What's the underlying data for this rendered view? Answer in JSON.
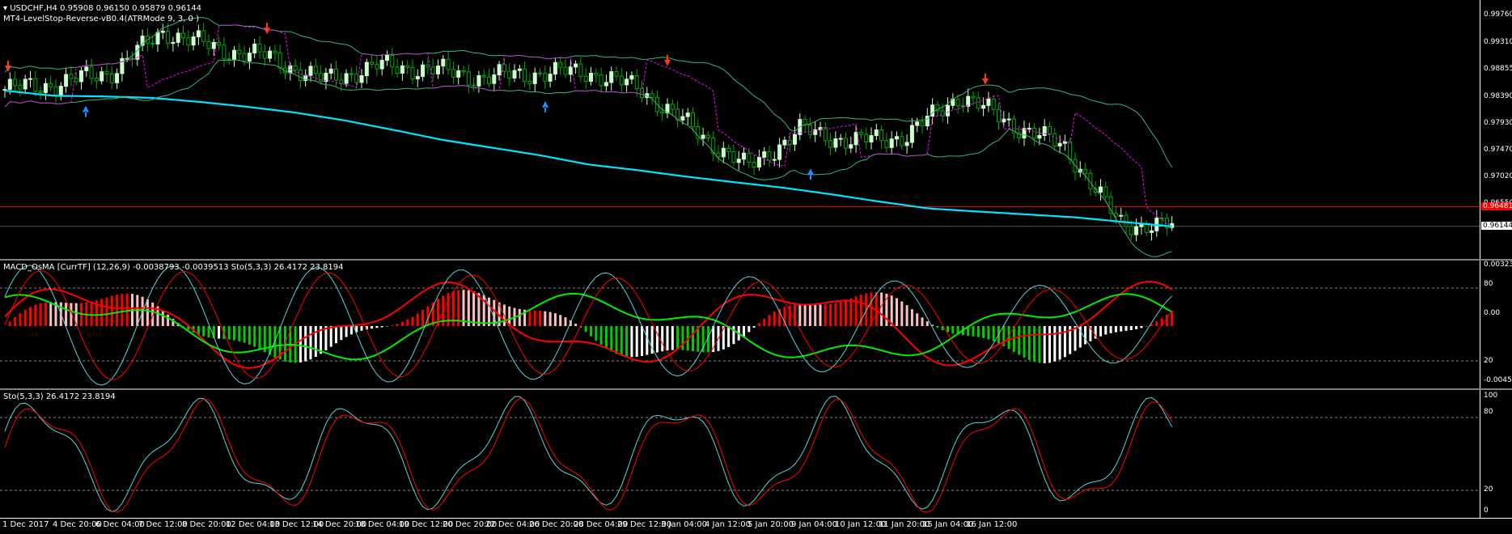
{
  "header": {
    "symbol_line": "USDCHF,H4  0.95908 0.96150 0.95879 0.96144",
    "indicator": "MT4-LevelStop-Reverse-vB0.4(ATRMode 9, 3, 0 )"
  },
  "macd_panel": {
    "title": "MACD_OsMA [CurrTF] (12,26,9) -0.0038793 -0.0039513  Sto(5,3,3) 26.4172 23.8194",
    "axis": [
      "0.003236",
      "80",
      "0.00",
      "20",
      "-0.004563"
    ]
  },
  "sto_panel": {
    "title": "Sto(5,3,3) 26.4172 23.8194",
    "axis": [
      "100",
      "80",
      "20",
      "0"
    ]
  },
  "price_axis": [
    "0.99760",
    "0.99310",
    "0.98855",
    "0.98390",
    "0.97930",
    "0.97470",
    "0.97020",
    "0.96550"
  ],
  "price_tags": {
    "level": "0.96481",
    "current": "0.96144"
  },
  "time_axis": [
    "1 Dec 2017",
    "4 Dec 20:00",
    "6 Dec 04:00",
    "7 Dec 12:00",
    "8 Dec 20:00",
    "12 Dec 04:00",
    "13 Dec 12:00",
    "14 Dec 20:00",
    "18 Dec 04:00",
    "19 Dec 12:00",
    "20 Dec 20:00",
    "22 Dec 04:00",
    "26 Dec 20:00",
    "28 Dec 04:00",
    "29 Dec 12:00",
    "3 Jan 04:00",
    "4 Jan 12:00",
    "5 Jan 20:00",
    "9 Jan 04:00",
    "10 Jan 12:00",
    "11 Jan 20:00",
    "15 Jan 04:00",
    "16 Jan 12:00"
  ],
  "colors": {
    "background": "#000000",
    "bull_candle": "#ccffcc",
    "bear_candle": "#00aa00",
    "ma_line": "#00e5ff",
    "bands": "#3cb371",
    "levelstop": "#ff00ff",
    "level_line": "#ff0000",
    "macd_up": "#ff0000",
    "macd_down": "#00cc00",
    "sto_main": "#5fd3d3",
    "sto_signal": "#ff0000"
  },
  "chart_data": {
    "type": "line",
    "series": [
      {
        "values": [
          0.98479,
          0.98391,
          0.9838,
          0.98356,
          0.98286,
          0.982,
          0.98098,
          0.97965,
          0.97802,
          0.97632,
          0.975,
          0.97368,
          0.97208,
          0.97112,
          0.97001,
          0.96904,
          0.9681,
          0.96695,
          0.96568,
          0.96452,
          0.964,
          0.9635,
          0.963,
          0.9622,
          0.96144
        ]
      }
    ],
    "x": [
      "1 Dec 2017",
      "4 Dec 20:00",
      "6 Dec 04:00",
      "7 Dec 12:00",
      "8 Dec 20:00",
      "12 Dec 04:00",
      "13 Dec 12:00",
      "14 Dec 20:00",
      "18 Dec 04:00",
      "19 Dec 12:00",
      "20 Dec 20:00",
      "22 Dec 04:00",
      "26 Dec 20:00",
      "28 Dec 04:00",
      "29 Dec 12:00",
      "3 Jan 04:00",
      "4 Jan 12:00",
      "5 Jan 20:00",
      "9 Jan 04:00",
      "10 Jan 12:00",
      "11 Jan 20:00",
      "15 Jan 04:00",
      "16 Jan 12:00"
    ],
    "price_close": [
      0.985,
      0.986,
      0.988,
      0.995,
      0.992,
      0.9905,
      0.9865,
      0.989,
      0.9885,
      0.987,
      0.9878,
      0.988,
      0.985,
      0.978,
      0.9715,
      0.978,
      0.976,
      0.977,
      0.984,
      0.979,
      0.975,
      0.962,
      0.9614
    ],
    "ylim": [
      0.9564,
      0.9976
    ]
  }
}
